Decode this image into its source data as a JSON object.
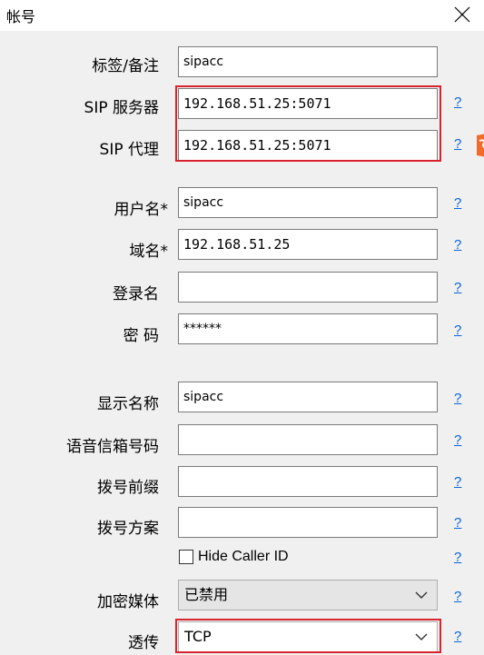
{
  "window": {
    "title": "帐号"
  },
  "fields": {
    "label": {
      "label": "标签/备注",
      "value": "sipacc"
    },
    "sip_server": {
      "label": "SIP 服务器",
      "value": "192.168.51.25:5071"
    },
    "sip_proxy": {
      "label": "SIP 代理",
      "value": "192.168.51.25:5071"
    },
    "username": {
      "label": "用户名*",
      "value": "sipacc"
    },
    "domain": {
      "label": "域名*",
      "value": "192.168.51.25"
    },
    "login": {
      "label": "登录名",
      "value": ""
    },
    "password": {
      "label": "密 码",
      "value": "******"
    },
    "display_name": {
      "label": "显示名称",
      "value": "sipacc"
    },
    "voicemail": {
      "label": "语音信箱号码",
      "value": ""
    },
    "dial_prefix": {
      "label": "拨号前缀",
      "value": ""
    },
    "dial_plan": {
      "label": "拨号方案",
      "value": ""
    }
  },
  "hide_caller_id": {
    "label": "Hide Caller ID",
    "checked": false
  },
  "encryption": {
    "label": "加密媒体",
    "value": "已禁用"
  },
  "transport": {
    "label": "透传",
    "value": "TCP"
  },
  "help_text": "?",
  "colors": {
    "highlight": "#d9232e",
    "link": "#0a64d8",
    "background": "#f0f0f0"
  }
}
